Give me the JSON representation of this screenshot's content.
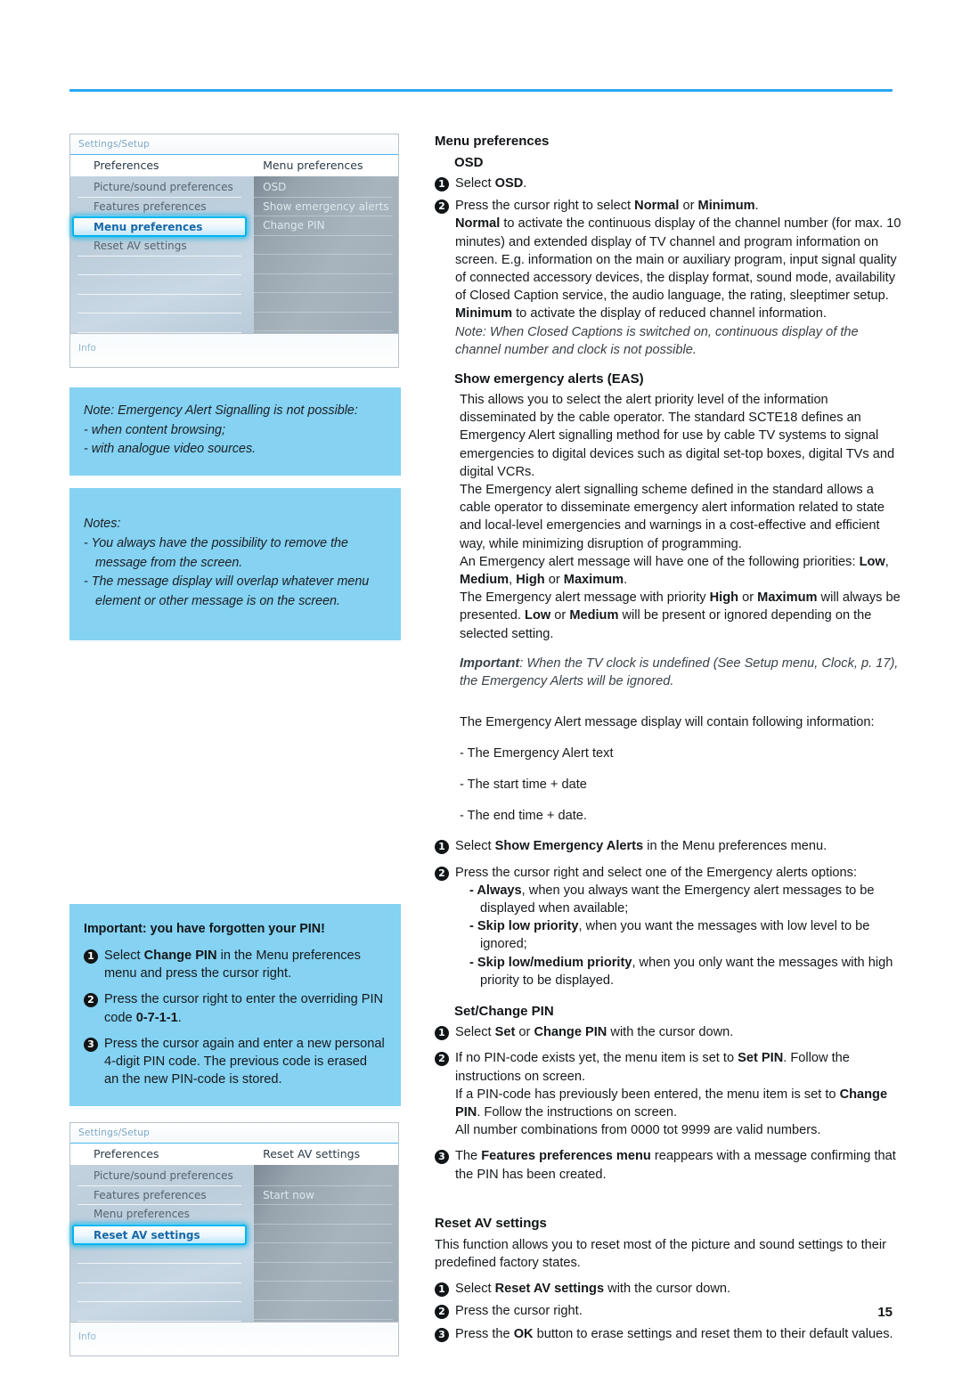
{
  "page": {
    "number": "15",
    "rule_color": "#2ba6f5",
    "note_bg": "#85d2f2"
  },
  "tv_menu_top": {
    "titlebar": "Settings/Setup",
    "header_left": "Preferences",
    "header_right": "Menu preferences",
    "left_items": [
      "Picture/sound preferences",
      "Features preferences",
      "Menu preferences",
      "Reset AV settings"
    ],
    "left_selected": "Menu preferences",
    "right_items": [
      "OSD",
      "Show emergency alerts",
      "Change PIN"
    ],
    "infobar": "Info"
  },
  "tv_menu_bottom": {
    "titlebar": "Settings/Setup",
    "header_left": "Preferences",
    "header_right": "Reset AV settings",
    "left_items": [
      "Picture/sound preferences",
      "Features preferences",
      "Menu preferences",
      "Reset AV settings"
    ],
    "left_selected": "Reset AV settings",
    "right_items": [
      "Start now"
    ],
    "infobar": "Info"
  },
  "note_eas": {
    "l1": "Note: Emergency Alert Signalling is not possible:",
    "l2": "- when content browsing;",
    "l3": "- with analogue video sources."
  },
  "note_notes": {
    "title": "Notes:",
    "l1": "- You always have the possibility to remove the message from the screen.",
    "l2": "- The message display will overlap whatever menu element or other message is on the screen."
  },
  "note_pin": {
    "title": "Important: you have forgotten your PIN!",
    "steps": [
      {
        "num": "1",
        "a": "Select ",
        "b": "Change PIN",
        "c": " in the Menu preferences menu and press the cursor right."
      },
      {
        "num": "2",
        "a": "Press the cursor right to enter the overriding PIN code ",
        "b": "0-7-1-1",
        "c": "."
      },
      {
        "num": "3",
        "a": "Press the cursor again and enter a new personal 4-digit PIN code. The previous code is erased an the new PIN-code is stored.",
        "b": "",
        "c": ""
      }
    ]
  },
  "menu_preferences": {
    "heading": "Menu preferences",
    "osd": {
      "subheading": "OSD",
      "step1_a": "Select ",
      "step1_b": "OSD",
      "step1_c": ".",
      "step2_a": "Press the cursor right to select ",
      "step2_b": "Normal",
      "step2_c": " or ",
      "step2_d": "Minimum",
      "step2_e": ".",
      "normal_b": "Normal",
      "normal_text": " to activate the continuous display of the channel number (for max. 10 minutes) and extended display of TV channel and program information on screen. E.g. information on the main or auxiliary program, input signal quality of connected accessory devices, the display format, sound mode, availability of Closed Caption service, the audio language, the rating, sleeptimer setup.",
      "minimum_b": "Minimum",
      "minimum_text": " to activate the display of reduced channel information.",
      "note": "Note: When Closed Captions is switched on, continuous display of the channel number and clock is not possible."
    },
    "eas": {
      "subheading": "Show emergency alerts (EAS)",
      "p1": "This allows you to select the alert priority level of the information disseminated by the cable operator. The standard SCTE18 defines an Emergency Alert signalling method for use by cable TV systems to signal emergencies to digital devices such as digital set-top boxes, digital TVs and digital VCRs.",
      "p2": "The Emergency alert signalling scheme defined in the standard allows a cable operator to disseminate emergency alert information related to state and local-level emergencies and warnings in a cost-effective and efficient way, while minimizing disruption of programming.",
      "p3_a": "An Emergency alert message will have one of the following priorities: ",
      "p3_b1": "Low",
      "p3_sep1": ", ",
      "p3_b2": "Medium",
      "p3_sep2": ", ",
      "p3_b3": "High",
      "p3_sep3": " or ",
      "p3_b4": "Maximum",
      "p3_end": ".",
      "p4_a": "The Emergency alert message with priority ",
      "p4_b1": "High",
      "p4_sep1": " or ",
      "p4_b2": "Maximum",
      "p4_mid": " will always be presented. ",
      "p4_b3": "Low",
      "p4_sep2": " or ",
      "p4_b4": "Medium",
      "p4_end": " will be present or ignored depending on the selected setting.",
      "important_b": "Important",
      "important_text": ": When the TV clock is undefined (See Setup menu, Clock, p. 17), the Emergency Alerts will be ignored.",
      "contains_intro": "The Emergency Alert message display will contain following information:",
      "contains_items": [
        "- The Emergency Alert text",
        "- The start time + date",
        "- The end time + date."
      ],
      "step1_a": "Select ",
      "step1_b": "Show Emergency Alerts",
      "step1_c": " in the Menu preferences menu.",
      "step2": "Press the cursor right and select one of the Emergency alerts options:",
      "options": [
        {
          "b": "- Always",
          "t": ", when you always want the Emergency alert messages to be displayed when available;"
        },
        {
          "b": "- Skip low priority",
          "t": ", when you want the messages with low level to be ignored;"
        },
        {
          "b": "- Skip low/medium priority",
          "t": ", when you only want the messages with high priority to be displayed."
        }
      ]
    },
    "setchangepin": {
      "subheading": "Set/Change PIN",
      "step1_a": "Select ",
      "step1_b": "Set",
      "step1_c": " or ",
      "step1_d": "Change PIN",
      "step1_e": " with the cursor down.",
      "step2_a": "If no PIN-code exists yet, the menu item is set to ",
      "step2_b": "Set PIN",
      "step2_c": ". Follow the instructions on screen.",
      "step2_l2_a": "If a PIN-code has previously been entered, the menu item is set to ",
      "step2_l2_b": "Change PIN",
      "step2_l2_c": ". Follow the instructions on screen.",
      "step2_l3": "All number combinations from 0000 tot 9999 are valid numbers.",
      "step3_a": "The ",
      "step3_b": "Features preferences menu",
      "step3_c": " reappears with a message confirming that the PIN has been created."
    },
    "reset_av": {
      "subheading": "Reset AV settings",
      "intro": "This function allows you to reset most of the picture and sound settings to their predefined factory states.",
      "step1_a": "Select ",
      "step1_b": "Reset AV settings",
      "step1_c": " with the cursor down.",
      "step2": "Press the cursor right.",
      "step3_a": "Press the ",
      "step3_b": "OK",
      "step3_c": " button to erase settings and reset them to their default values."
    }
  }
}
